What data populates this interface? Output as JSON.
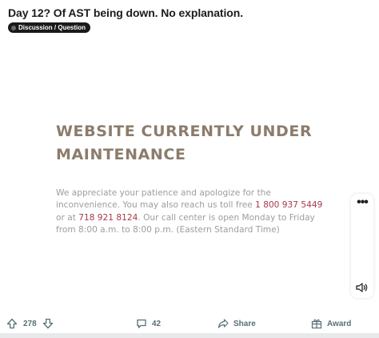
{
  "post": {
    "title": "Day 12? Of AST being down. No explanation.",
    "flair": "Discussion / Question"
  },
  "maintenance": {
    "heading": "WEBSITE CURRENTLY UNDER MAINTENANCE",
    "text_1": "We appreciate your patience and apologize for the inconvenience. You may also reach us toll free ",
    "phone_1": "1 800 937 5449",
    "text_2": " or at ",
    "phone_2": "718 921 8124",
    "text_3": ". Our call center is open Monday to Friday from 8:00 a.m. to 8:00 p.m. (Eastern Standard Time)"
  },
  "video_controls": {
    "more_label": "•••",
    "more_icon": "more-icon",
    "volume_icon": "volume-icon"
  },
  "actions": {
    "upvote_icon": "upvote-icon",
    "vote_count": "278",
    "downvote_icon": "downvote-icon",
    "comment_icon": "comment-icon",
    "comment_count": "42",
    "share_icon": "share-icon",
    "share_label": "Share",
    "award_icon": "award-icon",
    "award_label": "Award"
  },
  "colors": {
    "heading": "#8c7c6c",
    "body_text": "#9d9d9d",
    "phone": "#a8394a",
    "action_text": "#576f76",
    "flair_bg": "#1a1a1b"
  }
}
